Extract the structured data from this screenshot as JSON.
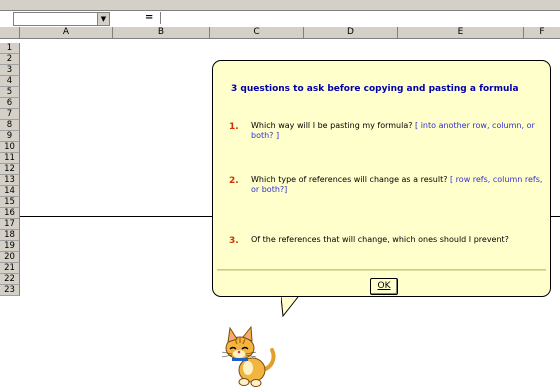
{
  "formula_bar": {
    "equals_label": "=",
    "cell_value": ""
  },
  "columns": [
    "A",
    "B",
    "C",
    "D",
    "E",
    "F"
  ],
  "rows": [
    "1",
    "2",
    "3",
    "4",
    "5",
    "6",
    "7",
    "8",
    "9",
    "10",
    "11",
    "12",
    "13",
    "14",
    "15",
    "16",
    "17",
    "18",
    "19",
    "20",
    "21",
    "22",
    "23"
  ],
  "callout": {
    "title": "3 questions to ask before copying and pasting a formula",
    "questions": [
      {
        "num": "1.",
        "text": "Which way will I be pasting my formula?",
        "hint": "[ into another row, column, or both? ]"
      },
      {
        "num": "2.",
        "text": "Which type of references will change as a result?",
        "hint": "[ row refs, column refs,  or both?]"
      },
      {
        "num": "3.",
        "text": "Of the references that will change, which ones should I prevent?",
        "hint": ""
      }
    ],
    "ok_label": "OK"
  },
  "assistant": {
    "icon": "office-cat-icon"
  },
  "colors": {
    "callout_bg": "#ffffcc",
    "title": "#0000aa",
    "number": "#cc3300",
    "hint": "#3333cc"
  }
}
